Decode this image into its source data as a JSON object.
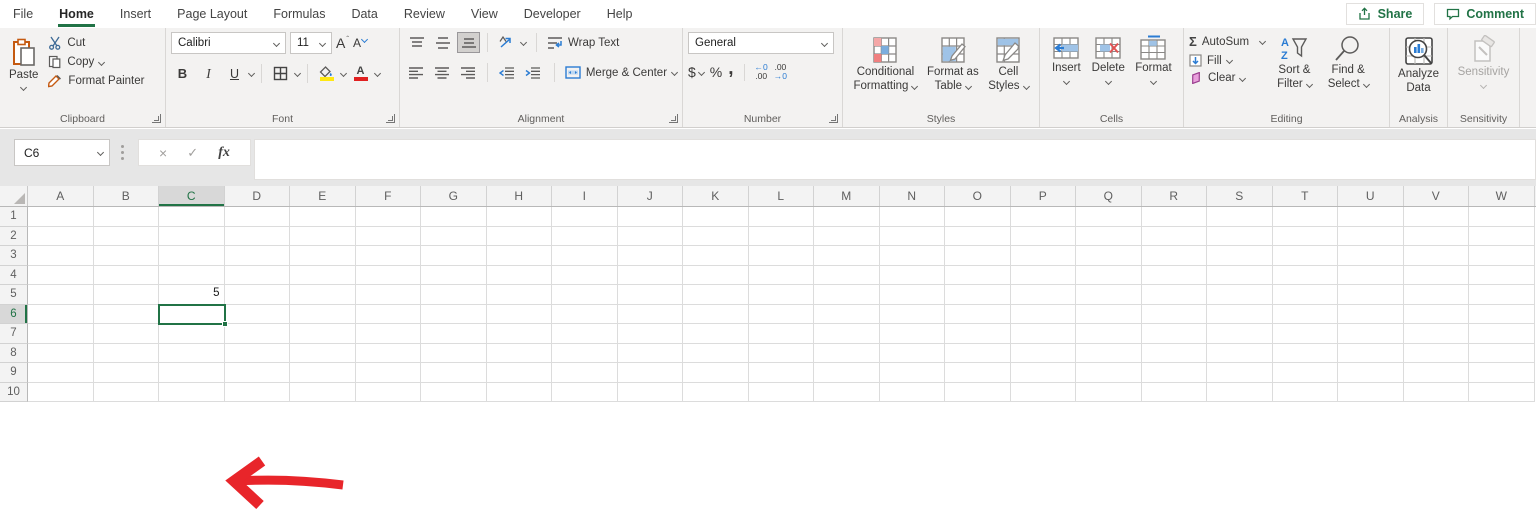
{
  "colors": {
    "accent_green": "#217346",
    "arrow_red": "#e8252a",
    "icon_blue": "#2b7cd3",
    "icon_orange": "#c55a11"
  },
  "menu": {
    "tabs": [
      {
        "label": "File",
        "active": false
      },
      {
        "label": "Home",
        "active": true
      },
      {
        "label": "Insert",
        "active": false
      },
      {
        "label": "Page Layout",
        "active": false
      },
      {
        "label": "Formulas",
        "active": false
      },
      {
        "label": "Data",
        "active": false
      },
      {
        "label": "Review",
        "active": false
      },
      {
        "label": "View",
        "active": false
      },
      {
        "label": "Developer",
        "active": false
      },
      {
        "label": "Help",
        "active": false
      }
    ],
    "share_label": "Share",
    "comment_label": "Comment"
  },
  "ribbon": {
    "clipboard": {
      "group_label": "Clipboard",
      "paste_label": "Paste",
      "cut_label": "Cut",
      "copy_label": "Copy",
      "format_painter_label": "Format Painter"
    },
    "font": {
      "group_label": "Font",
      "family": "Calibri",
      "size": "11",
      "bold_glyph": "B",
      "italic_glyph": "I",
      "underline_glyph": "U",
      "font_color_glyph": "A",
      "grow_glyph": "A",
      "shrink_glyph": "A"
    },
    "alignment": {
      "group_label": "Alignment",
      "wrap_text_label": "Wrap Text",
      "merge_center_label": "Merge & Center"
    },
    "number": {
      "group_label": "Number",
      "format_value": "General",
      "dollar_glyph": "$",
      "percent_glyph": "%",
      "comma_glyph": ",",
      "decimal_text": ".00",
      "arrow_left": "←",
      "arrow_right": "→",
      "zero": "0"
    },
    "styles": {
      "group_label": "Styles",
      "conditional_line1": "Conditional",
      "conditional_line2": "Formatting",
      "format_table_line1": "Format as",
      "format_table_line2": "Table",
      "cell_styles_line1": "Cell",
      "cell_styles_line2": "Styles"
    },
    "cells": {
      "group_label": "Cells",
      "insert_label": "Insert",
      "delete_label": "Delete",
      "format_label": "Format"
    },
    "editing": {
      "group_label": "Editing",
      "autosum_glyph": "Σ",
      "autosum_label": "AutoSum",
      "fill_label": "Fill",
      "clear_label": "Clear",
      "sort_line1": "Sort &",
      "sort_line2": "Filter",
      "sort_a": "A",
      "sort_z": "Z",
      "find_line1": "Find &",
      "find_line2": "Select"
    },
    "analysis": {
      "group_label": "Analysis",
      "analyze_line1": "Analyze",
      "analyze_line2": "Data"
    },
    "sensitivity": {
      "group_label": "Sensitivity",
      "button_label": "Sensitivity"
    }
  },
  "formula_bar": {
    "name_box_value": "C6",
    "cancel_glyph": "×",
    "enter_glyph": "✓",
    "fx_glyph": "fx",
    "formula_value": ""
  },
  "grid": {
    "columns": [
      "A",
      "B",
      "C",
      "D",
      "E",
      "F",
      "G",
      "H",
      "I",
      "J",
      "K",
      "L",
      "M",
      "N",
      "O",
      "P",
      "Q",
      "R",
      "S",
      "T",
      "U",
      "V",
      "W"
    ],
    "rows": [
      "1",
      "2",
      "3",
      "4",
      "5",
      "6",
      "7",
      "8",
      "9",
      "10"
    ],
    "active_column": "C",
    "active_row": "6",
    "selected_cell": "C6",
    "cells": [
      {
        "ref": "C5",
        "value": "5"
      }
    ]
  },
  "annotation": {
    "type": "red-arrow",
    "description": "hand-drawn red arrow pointing left at the value 5 in cell C5",
    "target": "C5"
  }
}
